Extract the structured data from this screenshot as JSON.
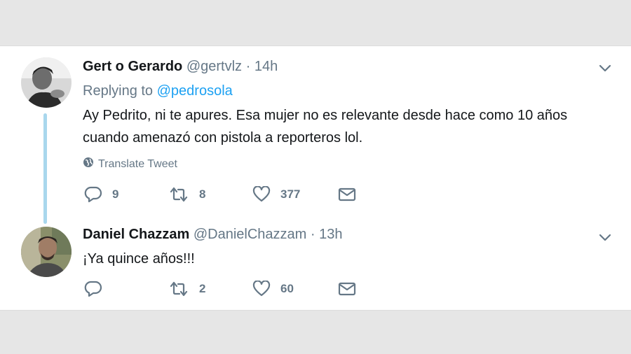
{
  "tweets": [
    {
      "name": "Gert o Gerardo",
      "handle": "@gertvlz",
      "separator": "·",
      "time": "14h",
      "replying_prefix": "Replying to",
      "replying_to": "@pedrosola",
      "text_line1": "Ay Pedrito, ni te apures. Esa mujer no es relevante desde hace como 10 años",
      "text_line2": "cuando amenazó con pistola a reporteros lol.",
      "translate_label": "Translate Tweet",
      "replies": "9",
      "retweets": "8",
      "likes": "377"
    },
    {
      "name": "Daniel Chazzam",
      "handle": "@DanielChazzam",
      "separator": "·",
      "time": "13h",
      "text_line1": "¡Ya quince años!!!",
      "replies": "",
      "retweets": "2",
      "likes": "60"
    }
  ],
  "colors": {
    "link": "#1da1f2",
    "secondary": "#657786",
    "thread_line": "#a9d7ed",
    "background": "#e6e6e6"
  },
  "icons": [
    "chevron-down-icon",
    "globe-icon",
    "reply-icon",
    "retweet-icon",
    "heart-icon",
    "envelope-icon"
  ]
}
